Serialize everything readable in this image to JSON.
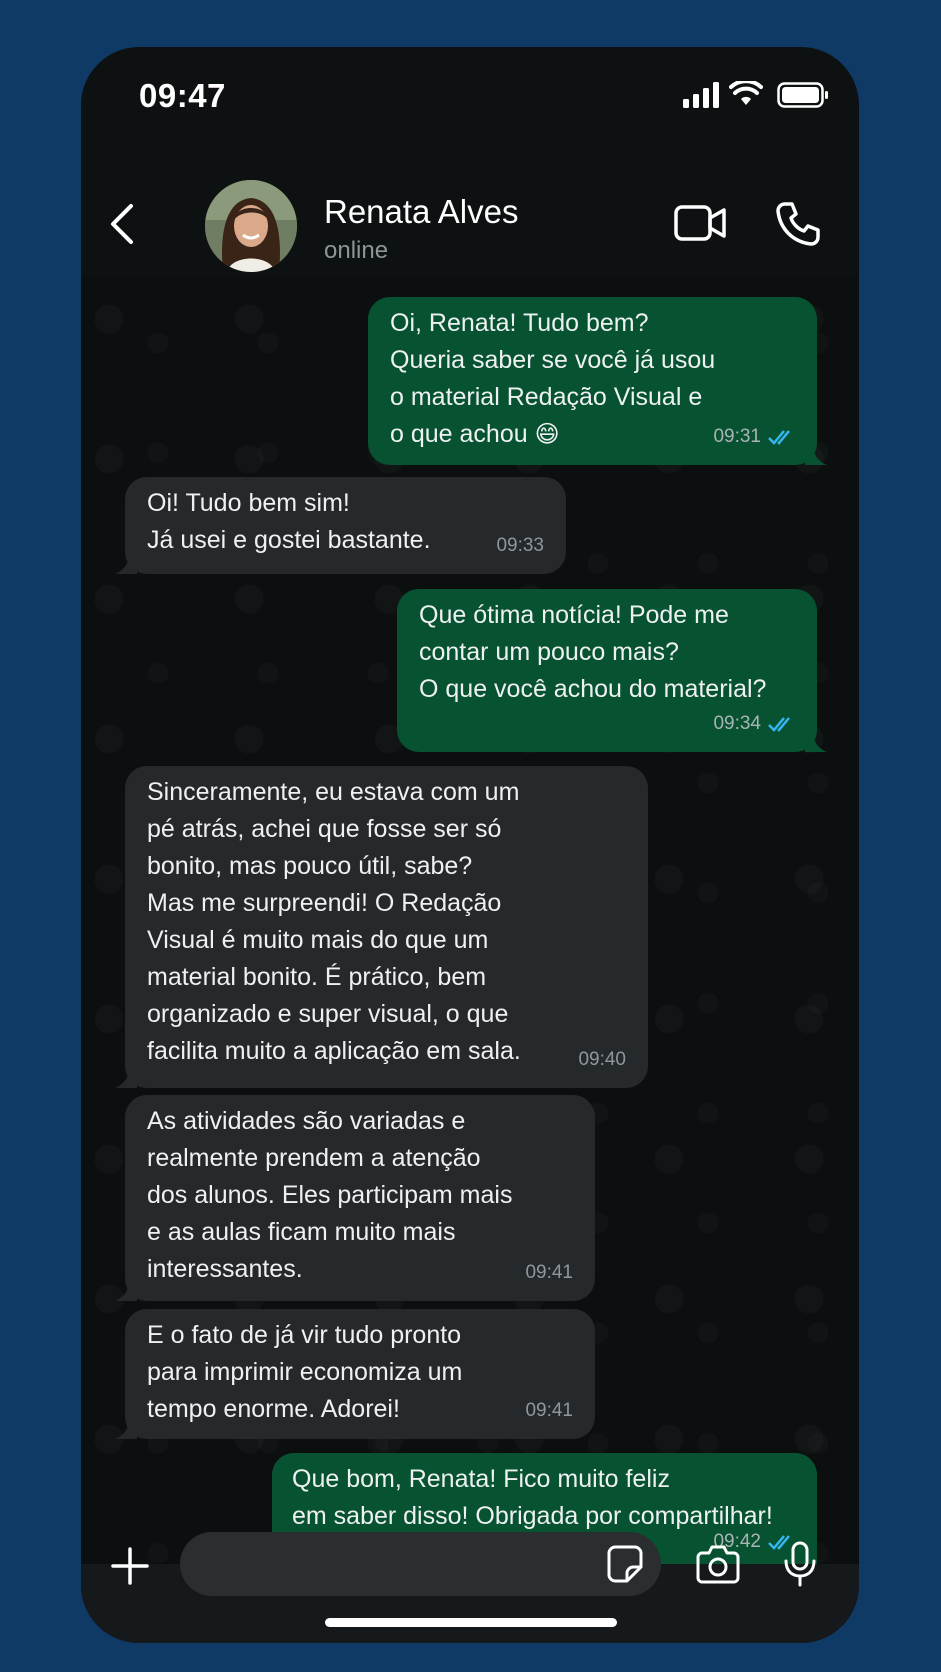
{
  "status_bar": {
    "time": "09:47",
    "icons": [
      "signal-icon",
      "wifi-icon",
      "battery-icon"
    ]
  },
  "header": {
    "contact_name": "Renata Alves",
    "contact_status": "online",
    "icons": [
      "back-arrow-icon",
      "video-call-icon",
      "phone-call-icon"
    ]
  },
  "messages": [
    {
      "direction": "out",
      "text": "Oi, Renata! Tudo bem?\nQueria saber se você já usou\no material Redação Visual e\no que achou",
      "emoji": "😄",
      "time": "09:31",
      "read": true
    },
    {
      "direction": "in",
      "text": "Oi! Tudo bem sim!\nJá usei e gostei bastante.",
      "time": "09:33"
    },
    {
      "direction": "out",
      "text": "Que ótima notícia! Pode me\ncontar um pouco mais?\nO que você achou do material?",
      "time": "09:34",
      "read": true
    },
    {
      "direction": "in",
      "text": "Sinceramente, eu estava com um\npé atrás, achei que fosse ser só\nbonito, mas pouco útil, sabe?\nMas me surpreendi! O Redação\nVisual é muito mais do que um\nmaterial bonito. É prático, bem\norganizado e super visual, o que\nfacilita muito a aplicação em sala.",
      "time": "09:40"
    },
    {
      "direction": "in",
      "text": "As atividades são variadas e\nrealmente prendem a atenção\ndos alunos. Eles participam mais\ne as aulas ficam muito mais\ninteressantes.",
      "time": "09:41"
    },
    {
      "direction": "in",
      "text": "E o fato de já vir tudo pronto\npara imprimir economiza um\ntempo enorme. Adorei!",
      "time": "09:41"
    },
    {
      "direction": "out",
      "text": "Que bom, Renata! Fico muito feliz\nem saber disso! Obrigada por compartilhar!",
      "emoji": "🙌",
      "time": "09:42",
      "read": true
    }
  ],
  "input_bar": {
    "placeholder": "",
    "icons": [
      "plus-icon",
      "sticker-icon",
      "camera-icon",
      "microphone-icon"
    ]
  },
  "colors": {
    "background": "#0f3a66",
    "phone": "#0e1112",
    "outgoing_bubble": "#075331",
    "incoming_bubble": "#25292c",
    "read_tick": "#34b7f1"
  }
}
